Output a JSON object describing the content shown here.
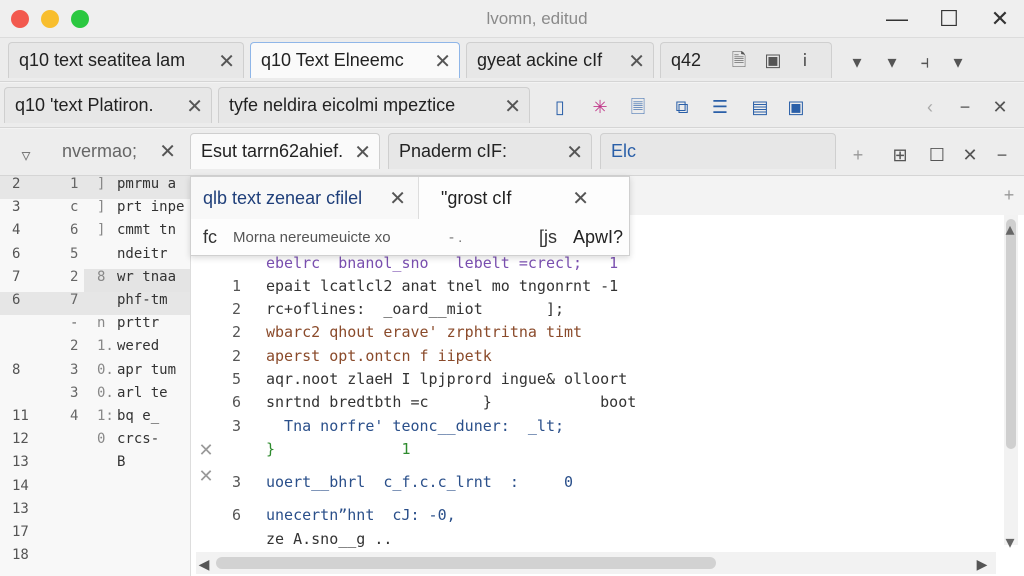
{
  "window": {
    "title": "lvomn, editud"
  },
  "tabs_row1": [
    {
      "label": "q10 text seatitea lam"
    },
    {
      "label": "q10 Text Elneemc"
    },
    {
      "label": "gyeat ackine cIf"
    },
    {
      "label": "q42"
    }
  ],
  "tabs_row2": [
    {
      "label": "q10 'text Platiron."
    },
    {
      "label": "tyfe neldira eicolmi mpeztice"
    }
  ],
  "tabs_row3": [
    {
      "label": "nvermao;"
    },
    {
      "label": "Esut tarrn62ahief."
    },
    {
      "label": "Pnaderm cIF:"
    },
    {
      "label": "Elc"
    }
  ],
  "popup": {
    "item1": "qlb text zenear cfilel",
    "item2": "\"grost cIf",
    "prefix": "fc",
    "desc": "Morna nereumeuicte xo",
    "hint": "- .",
    "key": "[js",
    "action": "ApwI?"
  },
  "gutter_lines": [
    {
      "n1": "2",
      "n2": "1",
      "n3": "]",
      "t": "pmrmu a"
    },
    {
      "n1": "3",
      "n2": "c",
      "n3": "]",
      "t": "prt inpe"
    },
    {
      "n1": "4",
      "n2": "6",
      "n3": "]",
      "t": "cmmt tn"
    },
    {
      "n1": "6",
      "n2": "5",
      "n3": "",
      "t": "ndeitr"
    },
    {
      "n1": "7",
      "n2": "2",
      "n3": "8",
      "t": "wr tnaa"
    },
    {
      "n1": "6",
      "n2": "7",
      "n3": "",
      "t": "phf-tm"
    },
    {
      "n1": "",
      "n2": "-",
      "n3": "n",
      "t": "prttr"
    },
    {
      "n1": "",
      "n2": "2",
      "n3": "1.",
      "t": "wered"
    },
    {
      "n1": "8",
      "n2": "3",
      "n3": "0.",
      "t": "apr tum"
    },
    {
      "n1": "",
      "n2": "3",
      "n3": "0.",
      "t": "arl te"
    },
    {
      "n1": "11",
      "n2": "4",
      "n3": "1:",
      "t": "bq e_"
    },
    {
      "n1": "12",
      "n2": "",
      "n3": "0",
      "t": "crcs-"
    },
    {
      "n1": "13",
      "n2": "",
      "n3": "",
      "t": "B"
    },
    {
      "n1": "14",
      "n2": "",
      "n3": "",
      "t": ""
    },
    {
      "n1": "13",
      "n2": "",
      "n3": "",
      "t": ""
    },
    {
      "n1": "17",
      "n2": "",
      "n3": "",
      "t": ""
    },
    {
      "n1": "18",
      "n2": "",
      "n3": "",
      "t": ""
    }
  ],
  "code_lines": [
    {
      "ln": "",
      "text": "ebelrc  bnanol_sno   lebelt =crecl;   1",
      "color": "#7a4fb0"
    },
    {
      "ln": "1",
      "text": "epait lcatlcl2 anat tnel mo tngonrnt -1",
      "color": "#333333"
    },
    {
      "ln": "2",
      "text": "rc+oflines:  _oard__miot       ];",
      "color": "#333333"
    },
    {
      "ln": "2",
      "text": "wbarc2 qhout erave' zrphtritna timt",
      "color": "#8a4a2a"
    },
    {
      "ln": "2",
      "text": "aperst opt.ontcn f iipetk",
      "color": "#8a4a2a"
    },
    {
      "ln": "5",
      "text": "aqr.noot zlaeH I lpjprord ingue& olloort",
      "color": "#333333"
    },
    {
      "ln": "6",
      "text": "snrtnd bredtbth =c      }            boot",
      "color": "#333333"
    },
    {
      "ln": "3",
      "text": "  Tna norfre' teonc__duner:  _lt;",
      "color": "#2a4f8a"
    },
    {
      "ln": "",
      "text": "}              1",
      "color": "#2e8b2e"
    },
    {
      "ln": "3",
      "text": "uoert__bhrl  c_f.c.c_lrnt  :     0",
      "color": "#2a4f8a"
    },
    {
      "ln": "6",
      "text": "unecertn”hnt  cJ: -0,",
      "color": "#2a4f8a"
    },
    {
      "ln": "",
      "text": "ze A.sno__g ..",
      "color": "#333333"
    }
  ]
}
